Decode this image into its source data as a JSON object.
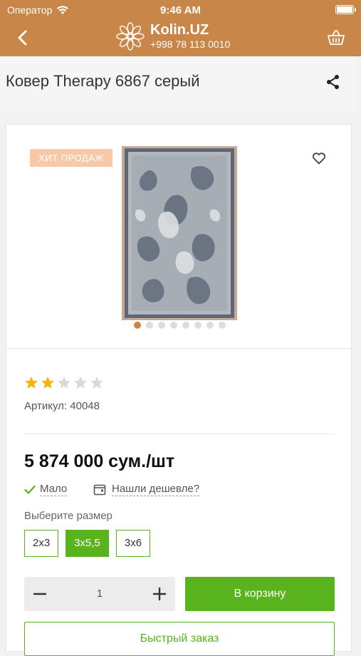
{
  "status_bar": {
    "carrier": "Оператор",
    "time": "9:46 AM",
    "battery_level": 1.0
  },
  "header": {
    "brand_name": "Kolin.UZ",
    "phone": "+998 78 113 0010"
  },
  "product": {
    "title": "Ковер Therapy 6867 серый",
    "badge": "ХИТ ПРОДАЖ",
    "gallery": {
      "image_count": 8,
      "active_index": 0
    },
    "rating": {
      "value": 2,
      "max": 5
    },
    "sku": "Артикул: 40048",
    "price": "5 874 000 сум./шт",
    "stock_status": "Мало",
    "cheaper_link": "Нашли дешевле?",
    "size_label": "Выберите размер",
    "sizes": [
      {
        "label": "2x3",
        "selected": false
      },
      {
        "label": "3x5,5",
        "selected": true
      },
      {
        "label": "3x6",
        "selected": false
      }
    ],
    "quantity": "1",
    "add_to_cart": "В корзину",
    "quick_order": "Быстрый заказ"
  },
  "colors": {
    "brand": "#c98649",
    "accent_green": "#58b31c",
    "star_filled": "#f6b500",
    "star_empty": "#d9d9d9",
    "badge_bg": "#f8c9a8"
  }
}
